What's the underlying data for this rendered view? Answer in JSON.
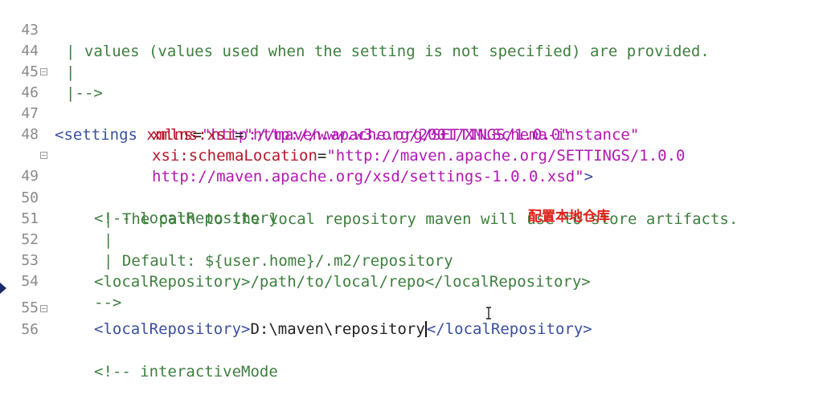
{
  "annotation": "配置本地仓库",
  "lines": [
    {
      "num": "43",
      "parts": [
        "| values (values used when the setting is not specified) are provided."
      ]
    },
    {
      "num": "44",
      "parts": [
        "|"
      ]
    },
    {
      "num": "45",
      "parts": [
        "|-->"
      ]
    },
    {
      "num": "46",
      "parts": [
        "<settings",
        " xmlns",
        "=",
        "\"http://maven.apache.org/SETTINGS/1.0.0\""
      ]
    },
    {
      "num": "47",
      "parts": [
        "xmlns:xsi",
        "=",
        "\"http://www.w3.org/2001/XMLSchema-instance\""
      ]
    },
    {
      "num": "48",
      "parts": [
        "xsi:schemaLocation",
        "=",
        "\"http://maven.apache.org/SETTINGS/1.0.0"
      ]
    },
    {
      "num": "",
      "parts": [
        "http://maven.apache.org/xsd/settings-1.0.0.xsd\"",
        ">"
      ]
    },
    {
      "num": "49",
      "parts": [
        "<!-- localRepository"
      ]
    },
    {
      "num": "50",
      "parts": [
        "| The path to the local repository maven will use to store artifacts."
      ]
    },
    {
      "num": "51",
      "parts": [
        "|"
      ]
    },
    {
      "num": "52",
      "parts": [
        "| Default: ${user.home}/.m2/repository"
      ]
    },
    {
      "num": "53",
      "parts": [
        "<localRepository>/path/to/local/repo</localRepository>"
      ]
    },
    {
      "num": "54",
      "parts": [
        "-->"
      ]
    },
    {
      "num": "55",
      "parts": [
        "<localRepository>",
        "D:\\maven\\repository",
        "</localRepository>"
      ]
    },
    {
      "num": "56",
      "parts": [
        "<!-- interactiveMode"
      ]
    }
  ]
}
